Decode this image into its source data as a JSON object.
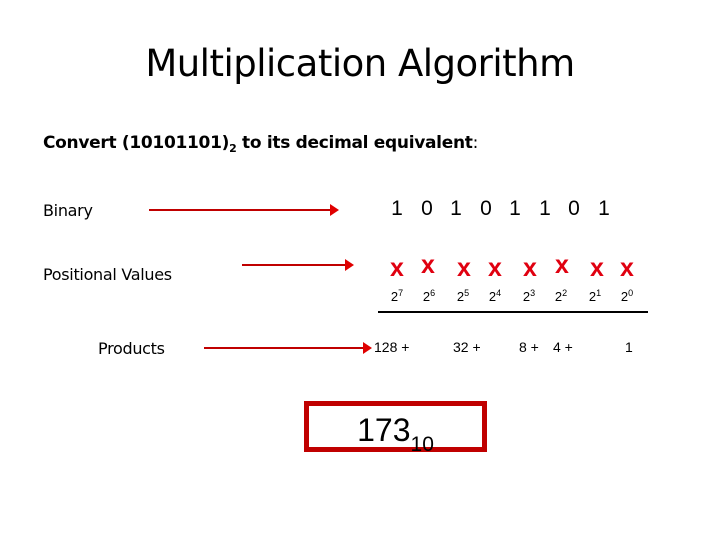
{
  "title": "Multiplication Algorithm",
  "subtitle": {
    "prefix": "Convert (10101101)",
    "base": "2",
    "suffix": " to its decimal equivalent",
    "colon": ":"
  },
  "labels": {
    "binary": "Binary",
    "positional": "Positional Values",
    "products": "Products"
  },
  "bits": [
    "1",
    "0",
    "1",
    "0",
    "1",
    "1",
    "0",
    "1"
  ],
  "multiply_symbol": "x",
  "powers": [
    {
      "base": "2",
      "exp": "7"
    },
    {
      "base": "2",
      "exp": "6"
    },
    {
      "base": "2",
      "exp": "5"
    },
    {
      "base": "2",
      "exp": "4"
    },
    {
      "base": "2",
      "exp": "3"
    },
    {
      "base": "2",
      "exp": "2"
    },
    {
      "base": "2",
      "exp": "1"
    },
    {
      "base": "2",
      "exp": "0"
    }
  ],
  "products": [
    "128 +",
    "32 +",
    "8 +",
    "4 +",
    "1"
  ],
  "result": {
    "value": "173",
    "base": "10"
  },
  "colors": {
    "accent": "#c00000",
    "x_mark": "#e00010"
  }
}
